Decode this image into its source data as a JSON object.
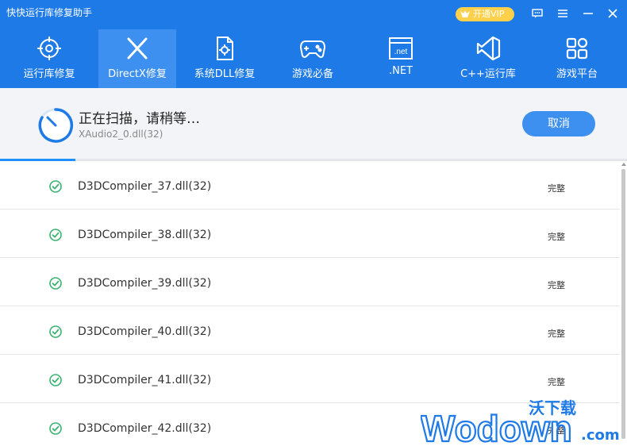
{
  "app": {
    "title": "快快运行库修复助手"
  },
  "vip": {
    "label": "开通VIP"
  },
  "window_buttons": [
    "feedback-icon",
    "menu-icon",
    "minimize-icon",
    "close-icon"
  ],
  "tabs": [
    {
      "label": "运行库修复",
      "icon": "target-icon",
      "active": false
    },
    {
      "label": "DirectX修复",
      "icon": "directx-icon",
      "active": true
    },
    {
      "label": "系统DLL修复",
      "icon": "dll-file-icon",
      "active": false
    },
    {
      "label": "游戏必备",
      "icon": "gamepad-icon",
      "active": false
    },
    {
      "label": ".NET",
      "icon": "dotnet-icon",
      "active": false
    },
    {
      "label": "C++运行库",
      "icon": "visual-studio-icon",
      "active": false
    },
    {
      "label": "游戏平台",
      "icon": "grid-icon",
      "active": false
    }
  ],
  "scan": {
    "title": "正在扫描，请稍等…",
    "current_file": "XAudio2_0.dll(32)",
    "cancel_label": "取消",
    "progress": 0.12
  },
  "items": [
    {
      "name": "D3DCompiler_37.dll(32)",
      "status": "完整"
    },
    {
      "name": "D3DCompiler_38.dll(32)",
      "status": "完整"
    },
    {
      "name": "D3DCompiler_39.dll(32)",
      "status": "完整"
    },
    {
      "name": "D3DCompiler_40.dll(32)",
      "status": "完整"
    },
    {
      "name": "D3DCompiler_41.dll(32)",
      "status": "完整"
    },
    {
      "name": "D3DCompiler_42.dll(32)",
      "status": "完整"
    }
  ],
  "watermark": {
    "top": "沃下载",
    "logo": "Wodown",
    "suffix": ".com"
  },
  "colors": {
    "header": "#1e7ae6",
    "active_tab": "#3d8ff0",
    "button": "#3d8ff0",
    "check": "#3cb371",
    "vip": "#ffd04b"
  }
}
